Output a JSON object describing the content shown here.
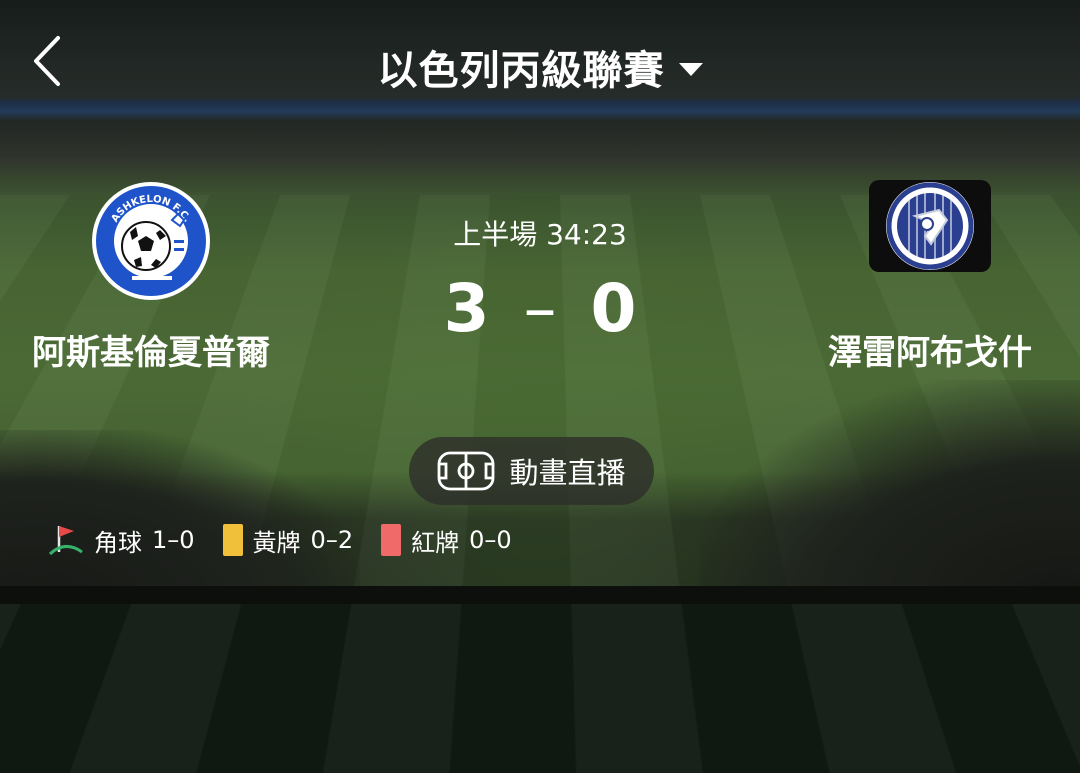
{
  "header": {
    "back_icon": "chevron-left-icon",
    "league_title": "以色列丙級聯賽",
    "dropdown_icon": "caret-down-icon"
  },
  "match": {
    "period_time": "上半場 34:23",
    "home": {
      "name": "阿斯基倫夏普爾",
      "logo_text": "ASHKELON F.C."
    },
    "away": {
      "name": "澤雷阿布戈什"
    },
    "score": {
      "home": "3",
      "separator": "–",
      "away": "0"
    }
  },
  "animation_button": {
    "icon": "pitch-icon",
    "label": "動畫直播"
  },
  "stats": [
    {
      "icon": "corner-flag-icon",
      "label": "角球",
      "value": "1–0"
    },
    {
      "icon": "yellow-card-icon",
      "label": "黃牌",
      "value": "0–2",
      "color": "#f1c03a"
    },
    {
      "icon": "red-card-icon",
      "label": "紅牌",
      "value": "0–0",
      "color": "#f06a6a"
    }
  ],
  "colors": {
    "home_logo_blue": "#1f53c9",
    "away_logo_navy": "#2a3f8f"
  }
}
